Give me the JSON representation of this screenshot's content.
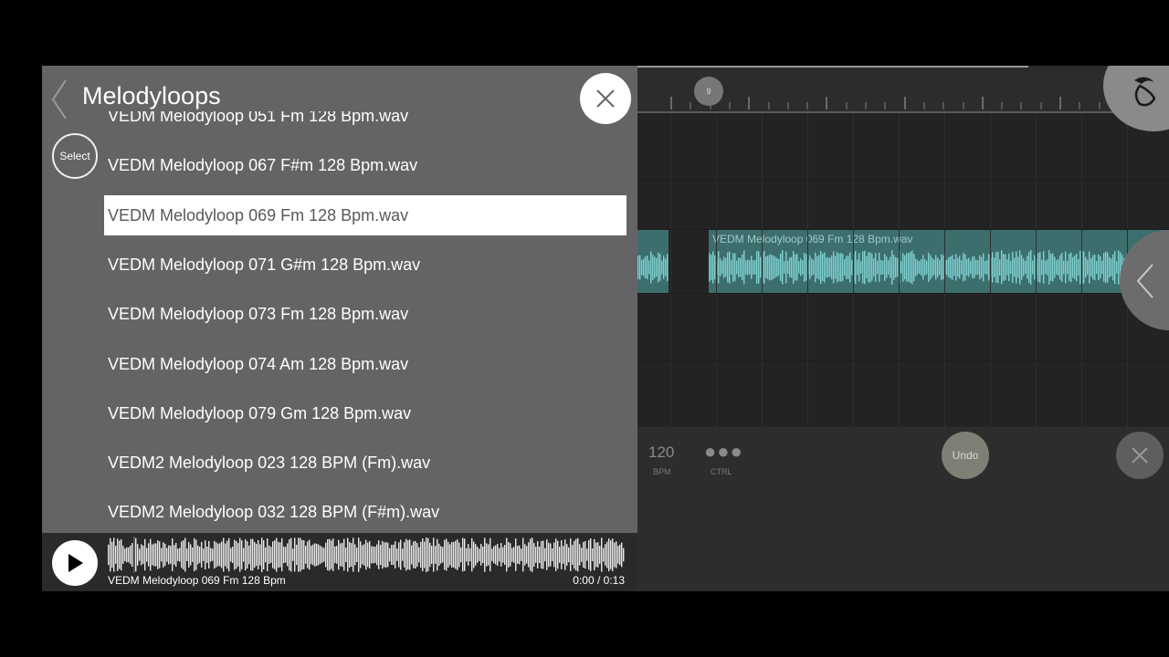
{
  "browser": {
    "title": "Melodyloops",
    "select_label": "Select",
    "files": [
      {
        "name": "VEDM Melodyloop 051 Fm 128 Bpm.wav",
        "selected": false
      },
      {
        "name": "VEDM Melodyloop 067 F#m 128 Bpm.wav",
        "selected": false
      },
      {
        "name": "VEDM Melodyloop 069 Fm 128 Bpm.wav",
        "selected": true
      },
      {
        "name": "VEDM Melodyloop 071 G#m 128 Bpm.wav",
        "selected": false
      },
      {
        "name": "VEDM Melodyloop 073 Fm 128 Bpm.wav",
        "selected": false
      },
      {
        "name": "VEDM Melodyloop 074 Am 128 Bpm.wav",
        "selected": false
      },
      {
        "name": "VEDM Melodyloop 079 Gm 128 Bpm.wav",
        "selected": false
      },
      {
        "name": "VEDM2 Melodyloop 023 128 BPM (Fm).wav",
        "selected": false
      },
      {
        "name": "VEDM2 Melodyloop 032 128 BPM (F#m).wav",
        "selected": false
      }
    ]
  },
  "player": {
    "name": "VEDM Melodyloop 069 Fm 128 Bpm",
    "time": "0:00 / 0:13",
    "progress": 0.0
  },
  "daw": {
    "marker": "9",
    "clip_title": "VEDM Melodyloop 069 Fm 128 Bpm.wav",
    "bpm_value": "120",
    "bpm_label": "BPM",
    "ctrl_label": "CTRL",
    "undo_label": "Undo"
  },
  "colors": {
    "panel_bg": "#646366",
    "clip_teal": "#3d6e6e",
    "wave_teal": "#7fd0d0"
  },
  "icons": {
    "back": "chevron-left-icon",
    "close": "close-icon",
    "play": "play-icon",
    "logo": "fl-fruit-logo-icon",
    "side": "chevron-left-icon"
  }
}
